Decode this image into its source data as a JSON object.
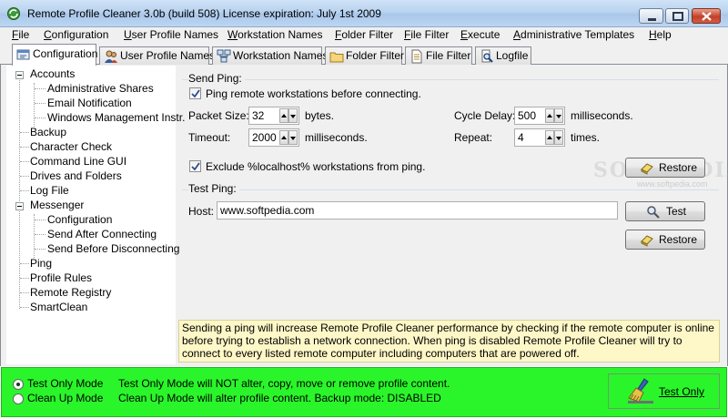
{
  "window": {
    "title": "Remote Profile Cleaner 3.0b (build 508)   License expiration: July 1st 2009"
  },
  "menu": [
    {
      "label": "File",
      "underline": "F",
      "rest": "ile"
    },
    {
      "label": "Configuration",
      "underline": "C",
      "rest": "onfiguration"
    },
    {
      "label": "User Profile Names",
      "underline": "U",
      "rest": "ser Profile Names"
    },
    {
      "label": "Workstation Names",
      "underline": "W",
      "rest": "orkstation Names"
    },
    {
      "label": "Folder Filter",
      "underline": "F",
      "rest": "older Filter"
    },
    {
      "label": "File Filter",
      "underline": "F",
      "rest": "ile Filter"
    },
    {
      "label": "Execute",
      "underline": "E",
      "rest": "xecute"
    },
    {
      "label": "Administrative Templates",
      "underline": "A",
      "rest": "dministrative Templates"
    },
    {
      "label": "Help",
      "underline": "H",
      "rest": "elp"
    }
  ],
  "tabs": [
    {
      "label": "Configuration",
      "icon": "configuration-icon",
      "active": true
    },
    {
      "label": "User Profile Names",
      "icon": "users-icon"
    },
    {
      "label": "Workstation Names",
      "icon": "network-icon"
    },
    {
      "label": "Folder Filter",
      "icon": "folder-icon"
    },
    {
      "label": "File Filter",
      "icon": "document-icon"
    },
    {
      "label": "Logfile",
      "icon": "magnifier-icon"
    }
  ],
  "tree": [
    {
      "label": "Accounts",
      "level": 0,
      "expanded": true
    },
    {
      "label": "Administrative Shares",
      "level": 1
    },
    {
      "label": "Email Notification",
      "level": 1
    },
    {
      "label": "Windows Management Instr.",
      "level": 1
    },
    {
      "label": "Backup",
      "level": 0
    },
    {
      "label": "Character Check",
      "level": 0
    },
    {
      "label": "Command Line GUI",
      "level": 0
    },
    {
      "label": "Drives and Folders",
      "level": 0
    },
    {
      "label": "Log File",
      "level": 0
    },
    {
      "label": "Messenger",
      "level": 0,
      "expanded": true
    },
    {
      "label": "Configuration",
      "level": 1
    },
    {
      "label": "Send After Connecting",
      "level": 1
    },
    {
      "label": "Send Before Disconnecting",
      "level": 1
    },
    {
      "label": "Ping",
      "level": 0
    },
    {
      "label": "Profile Rules",
      "level": 0
    },
    {
      "label": "Remote Registry",
      "level": 0
    },
    {
      "label": "SmartClean",
      "level": 0
    }
  ],
  "send_ping": {
    "section": "Send Ping:",
    "ping_check_label": "Ping remote workstations before connecting.",
    "ping_checked": true,
    "packet_size_label": "Packet Size:",
    "packet_size": "32",
    "packet_size_unit": "bytes.",
    "timeout_label": "Timeout:",
    "timeout": "2000",
    "timeout_unit": "milliseconds.",
    "cycle_delay_label": "Cycle Delay:",
    "cycle_delay": "500",
    "cycle_delay_unit": "milliseconds.",
    "repeat_label": "Repeat:",
    "repeat": "4",
    "repeat_unit": "times.",
    "exclude_label": "Exclude %localhost% workstations from ping.",
    "exclude_checked": true,
    "restore_label": "Restore"
  },
  "test_ping": {
    "section": "Test Ping:",
    "host_label": "Host:",
    "host_value": "www.softpedia.com",
    "test_label": "Test",
    "restore_label": "Restore"
  },
  "watermark": {
    "main": "SOFTPEDIA",
    "sub": "www.softpedia.com"
  },
  "info_text": "Sending a ping will increase Remote Profile Cleaner performance by checking if the remote computer is online before trying to establish a network connection. When ping is disabled Remote Profile Cleaner will try to connect to every listed remote computer including computers that are powered off.",
  "modes": [
    {
      "label": "Test Only Mode",
      "description": "Test Only Mode will NOT alter, copy, move or remove profile content.",
      "selected": true
    },
    {
      "label": "Clean Up Mode",
      "description": "Clean Up Mode will alter profile content. Backup mode: DISABLED",
      "selected": false
    }
  ],
  "run_button_label": "Test Only",
  "colors": {
    "mode_bar": "#2af52a",
    "info_background": "#fef7c7"
  }
}
